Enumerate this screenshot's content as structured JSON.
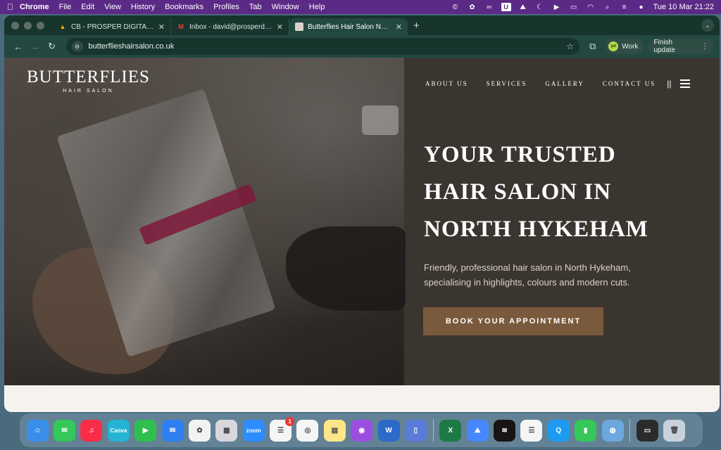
{
  "menubar": {
    "app_name": "Chrome",
    "menus": [
      "File",
      "Edit",
      "View",
      "History",
      "Bookmarks",
      "Profiles",
      "Tab",
      "Window",
      "Help"
    ],
    "datetime": "Tue 10 Mar  21:22"
  },
  "tabs": [
    {
      "title": "CB - PROSPER DIGITAL - Goo",
      "icon": "google-drive-icon"
    },
    {
      "title": "Inbox - david@prosperdigital.",
      "icon": "gmail-icon"
    },
    {
      "title": "Butterflies Hair Salon North H",
      "icon": "site-favicon"
    }
  ],
  "toolbar": {
    "url": "butterflieshairsalon.co.uk",
    "profile_label": "Work",
    "update_label": "Finish update"
  },
  "site": {
    "logo_main": "BUTTERFLIES",
    "logo_sub": "HAIR SALON",
    "nav": [
      "ABOUT US",
      "SERVICES",
      "GALLERY",
      "CONTACT US"
    ],
    "nav_divider": "||",
    "headline": [
      "YOUR TRUSTED",
      "HAIR SALON IN",
      "NORTH HYKEHAM"
    ],
    "subtext": "Friendly, professional hair salon in North Hykeham, specialising in highlights, colours and modern cuts.",
    "cta": "BOOK YOUR APPOINTMENT",
    "accent_color": "#7a5a3c"
  },
  "dock": {
    "apps": [
      {
        "name": "finder-icon",
        "color": "#3a8fe8",
        "glyph": "☺"
      },
      {
        "name": "messages-icon",
        "color": "#34c759",
        "glyph": "✉"
      },
      {
        "name": "music-icon",
        "color": "#fa2d48",
        "glyph": "♫"
      },
      {
        "name": "canva-icon",
        "color": "#23b5d3",
        "glyph": "Canva"
      },
      {
        "name": "facetime-icon",
        "color": "#2fbf4f",
        "glyph": "▶"
      },
      {
        "name": "mail-icon",
        "color": "#2e7ff0",
        "glyph": "✉"
      },
      {
        "name": "chatgpt-icon",
        "color": "#f2f2f2",
        "glyph": "✿"
      },
      {
        "name": "launchpad-icon",
        "color": "#d7d7dc",
        "glyph": "▦"
      },
      {
        "name": "zoom-icon",
        "color": "#2d8cff",
        "glyph": "zoom"
      },
      {
        "name": "reminders-icon",
        "color": "#f5f5f5",
        "glyph": "☰",
        "badge": "1"
      },
      {
        "name": "chrome-icon",
        "color": "#f5f5f5",
        "glyph": "◎"
      },
      {
        "name": "notes-icon",
        "color": "#fde68a",
        "glyph": "▤"
      },
      {
        "name": "podcasts-icon",
        "color": "#9b4fe0",
        "glyph": "◉"
      },
      {
        "name": "word-icon",
        "color": "#2b6ac9",
        "glyph": "W"
      },
      {
        "name": "simulator-icon",
        "color": "#5a7bd8",
        "glyph": "▯"
      },
      {
        "name": "excel-icon",
        "color": "#1e7a45",
        "glyph": "X"
      },
      {
        "name": "nordvpn-icon",
        "color": "#4687ff",
        "glyph": "⛰"
      },
      {
        "name": "spotify-icon",
        "color": "#191414",
        "glyph": "≋"
      },
      {
        "name": "docs-icon",
        "color": "#f5f5f5",
        "glyph": "☰"
      },
      {
        "name": "quicktime-icon",
        "color": "#1d9bf0",
        "glyph": "Q"
      },
      {
        "name": "numbers-icon",
        "color": "#34c759",
        "glyph": "▮"
      },
      {
        "name": "files-icon",
        "color": "#6da7e0",
        "glyph": "◍"
      },
      {
        "name": "screen-thumbnail-icon",
        "color": "#2b2b2b",
        "glyph": "▭"
      },
      {
        "name": "trash-icon",
        "color": "#c8d2da",
        "glyph": "🗑"
      }
    ]
  }
}
